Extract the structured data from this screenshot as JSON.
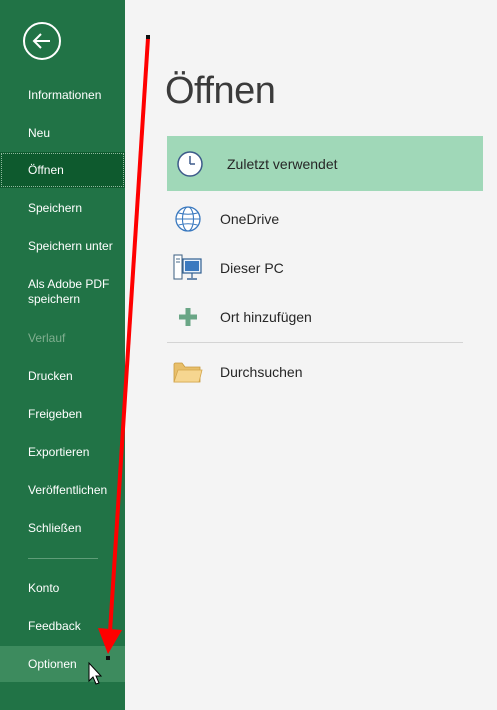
{
  "sidebar": {
    "back_icon": "back-arrow-icon",
    "items": [
      {
        "label": "Informationen",
        "state": "normal"
      },
      {
        "label": "Neu",
        "state": "normal"
      },
      {
        "label": "Öffnen",
        "state": "active"
      },
      {
        "label": "Speichern",
        "state": "normal"
      },
      {
        "label": "Speichern unter",
        "state": "normal"
      },
      {
        "label": "Als Adobe PDF speichern",
        "state": "normal"
      },
      {
        "label": "Verlauf",
        "state": "disabled"
      },
      {
        "label": "Drucken",
        "state": "normal"
      },
      {
        "label": "Freigeben",
        "state": "normal"
      },
      {
        "label": "Exportieren",
        "state": "normal"
      },
      {
        "label": "Veröffentlichen",
        "state": "normal"
      },
      {
        "label": "Schließen",
        "state": "normal"
      }
    ],
    "bottom_items": [
      {
        "label": "Konto",
        "state": "normal"
      },
      {
        "label": "Feedback",
        "state": "normal"
      },
      {
        "label": "Optionen",
        "state": "hovered"
      }
    ]
  },
  "main": {
    "title": "Öffnen",
    "locations": [
      {
        "label": "Zuletzt verwendet",
        "icon": "clock-icon",
        "selected": true
      },
      {
        "label": "OneDrive",
        "icon": "globe-icon",
        "selected": false
      },
      {
        "label": "Dieser PC",
        "icon": "computer-icon",
        "selected": false
      },
      {
        "label": "Ort hinzufügen",
        "icon": "plus-icon",
        "selected": false
      },
      {
        "label": "Durchsuchen",
        "icon": "folder-icon",
        "selected": false
      }
    ]
  },
  "colors": {
    "sidebar_bg": "#217346",
    "active_bg": "#0e5a2e",
    "selected_location_bg": "#a0d8b8",
    "annotation_arrow": "#ff0000"
  }
}
